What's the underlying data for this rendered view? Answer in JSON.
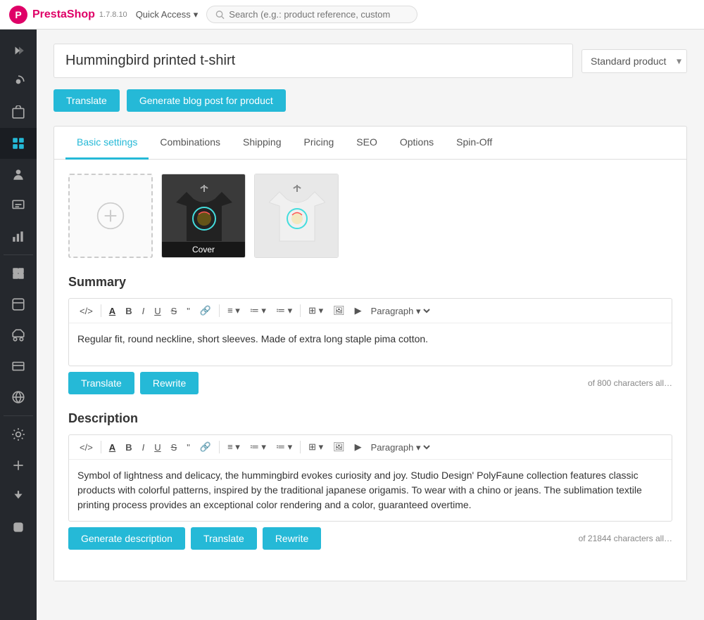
{
  "topbar": {
    "logo_text": "PrestaShop",
    "version": "1.7.8.10",
    "quick_access_label": "Quick Access",
    "search_placeholder": "Search (e.g.: product reference, custom"
  },
  "product": {
    "title": "Hummingbird printed t-shirt",
    "type": "Standard product"
  },
  "buttons": {
    "translate": "Translate",
    "generate_blog": "Generate blog post for product",
    "summary_translate": "Translate",
    "summary_rewrite": "Rewrite",
    "desc_generate": "Generate description",
    "desc_translate": "Translate",
    "desc_rewrite": "Rewrite"
  },
  "tabs": [
    {
      "id": "basic",
      "label": "Basic settings",
      "active": true
    },
    {
      "id": "combinations",
      "label": "Combinations"
    },
    {
      "id": "shipping",
      "label": "Shipping"
    },
    {
      "id": "pricing",
      "label": "Pricing"
    },
    {
      "id": "seo",
      "label": "SEO"
    },
    {
      "id": "options",
      "label": "Options"
    },
    {
      "id": "spinoff",
      "label": "Spin-Off"
    }
  ],
  "images": {
    "upload_hint": "+",
    "cover_label": "Cover"
  },
  "summary": {
    "title": "Summary",
    "content": "Regular fit, round neckline, short sleeves. Made of extra long staple pima cotton.",
    "char_count": "of 800 characters all…",
    "toolbar": {
      "paragraph_label": "Paragraph ▾"
    }
  },
  "description": {
    "title": "Description",
    "content": "Symbol of lightness and delicacy, the hummingbird evokes curiosity and joy. Studio Design' PolyFaune collection features classic products with colorful patterns, inspired by the traditional japanese origamis. To wear with a chino or jeans. The sublimation textile printing process provides an exceptional color rendering and a color, guaranteed overtime.",
    "char_count": "of 21844 characters all…",
    "toolbar": {
      "paragraph_label": "Paragraph ▾"
    }
  },
  "sidebar": {
    "items": [
      {
        "name": "expand-icon",
        "icon": "≫"
      },
      {
        "name": "dashboard-icon",
        "icon": "⚡"
      },
      {
        "name": "orders-icon",
        "icon": "🛒"
      },
      {
        "name": "catalog-icon",
        "icon": "📦",
        "active": true
      },
      {
        "name": "customers-icon",
        "icon": "👤"
      },
      {
        "name": "messages-icon",
        "icon": "✉"
      },
      {
        "name": "stats-icon",
        "icon": "📊"
      },
      {
        "name": "modules-icon",
        "icon": "🔌"
      },
      {
        "name": "design-icon",
        "icon": "🖥"
      },
      {
        "name": "shipping-icon",
        "icon": "🚚"
      },
      {
        "name": "payment-icon",
        "icon": "💳"
      },
      {
        "name": "international-icon",
        "icon": "🌐"
      },
      {
        "name": "settings-icon",
        "icon": "⚙"
      },
      {
        "name": "advanced-icon",
        "icon": "🔧"
      },
      {
        "name": "plugin1-icon",
        "icon": "🧩"
      },
      {
        "name": "plugin2-icon",
        "icon": "🧩"
      }
    ]
  }
}
